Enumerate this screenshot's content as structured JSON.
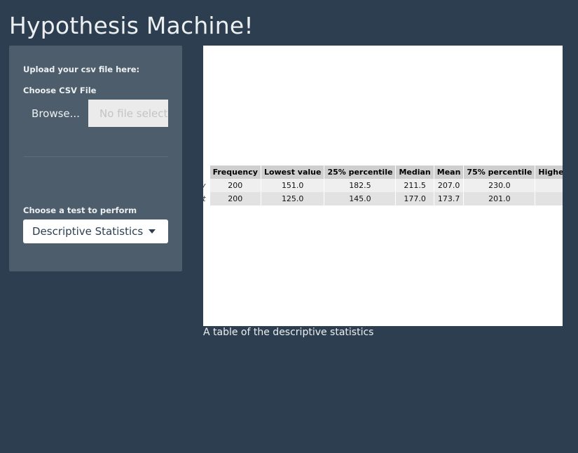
{
  "app": {
    "title": "Hypothesis Machine!"
  },
  "sidebar": {
    "upload_heading": "Upload your csv file here:",
    "file_label": "Choose CSV File",
    "browse_label": "Browse...",
    "file_placeholder": "No file selected",
    "test_label": "Choose a test to perform",
    "test_selected": "Descriptive Statistics"
  },
  "table": {
    "columns": [
      "Frequency",
      "Lowest value",
      "25% percentile",
      "Median",
      "Mean",
      "75% percentile",
      "Highest value"
    ],
    "rows": [
      {
        "label": "Day",
        "values": [
          "200",
          "151.0",
          "182.5",
          "211.5",
          "207.0",
          "230.0",
          ""
        ]
      },
      {
        "label": "Night",
        "values": [
          "200",
          "125.0",
          "145.0",
          "177.0",
          "173.7",
          "201.0",
          ""
        ]
      }
    ]
  },
  "caption": "A table of the descriptive statistics",
  "colors": {
    "background": "#2c3e50",
    "sidebar": "#4e5d6c",
    "text": "#ecf0f1",
    "header_cell": "#cfcfcf"
  }
}
